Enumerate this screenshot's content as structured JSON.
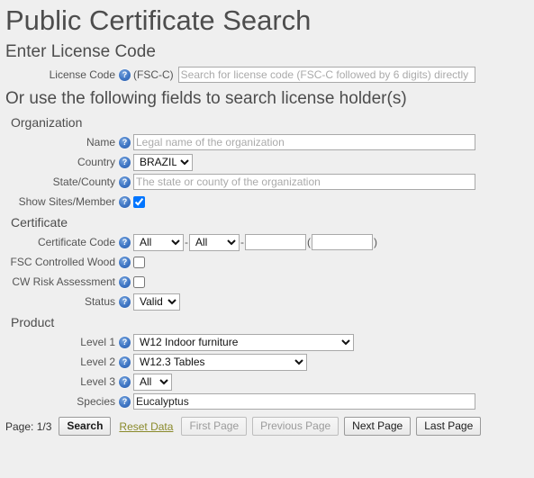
{
  "page": {
    "title": "Public Certificate Search"
  },
  "license_section": {
    "heading": "Enter License Code",
    "license_code": {
      "label": "License Code",
      "help_icon": "help-question-icon",
      "suffix": "(FSC-C)",
      "value": "",
      "placeholder": "Search for license code (FSC-C followed by 6 digits) directly"
    }
  },
  "holder_section": {
    "heading": "Or use the following fields to search license holder(s)",
    "organization": {
      "group_label": "Organization",
      "name": {
        "label": "Name",
        "help_icon": "help-question-icon",
        "value": "",
        "placeholder": "Legal name of the organization"
      },
      "country": {
        "label": "Country",
        "help_icon": "help-question-icon",
        "selected": "BRAZIL",
        "options": [
          "BRAZIL"
        ]
      },
      "state_county": {
        "label": "State/County",
        "help_icon": "help-question-icon",
        "value": "",
        "placeholder": "The state or county of the organization"
      },
      "show_sites_member": {
        "label": "Show Sites/Member",
        "help_icon": "help-question-icon",
        "checked": true
      }
    },
    "certificate": {
      "group_label": "Certificate",
      "certificate_code": {
        "label": "Certificate Code",
        "help_icon": "help-question-icon",
        "part1_selected": "All",
        "part1_options": [
          "All"
        ],
        "separator1": "-",
        "part2_selected": "All",
        "part2_options": [
          "All"
        ],
        "separator2": "-",
        "part3_value": "",
        "paren_open": "(",
        "part4_value": "",
        "paren_close": ")"
      },
      "fsc_controlled_wood": {
        "label": "FSC Controlled Wood",
        "help_icon": "help-question-icon",
        "checked": false
      },
      "cw_risk_assessment": {
        "label": "CW Risk Assessment",
        "help_icon": "help-question-icon",
        "checked": false
      },
      "status": {
        "label": "Status",
        "help_icon": "help-question-icon",
        "selected": "Valid",
        "options": [
          "Valid"
        ]
      }
    },
    "product": {
      "group_label": "Product",
      "level1": {
        "label": "Level 1",
        "help_icon": "help-question-icon",
        "selected": "W12 Indoor furniture",
        "options": [
          "W12 Indoor furniture"
        ]
      },
      "level2": {
        "label": "Level 2",
        "help_icon": "help-question-icon",
        "selected": "W12.3 Tables",
        "options": [
          "W12.3 Tables"
        ]
      },
      "level3": {
        "label": "Level 3",
        "help_icon": "help-question-icon",
        "selected": "All",
        "options": [
          "All"
        ]
      },
      "species": {
        "label": "Species",
        "help_icon": "help-question-icon",
        "value": "Eucalyptus",
        "placeholder": ""
      }
    }
  },
  "toolbar": {
    "page_indicator": "Page: 1/3",
    "search_label": "Search",
    "reset_label": "Reset Data",
    "first_page_label": "First Page",
    "previous_page_label": "Previous Page",
    "next_page_label": "Next Page",
    "last_page_label": "Last Page",
    "first_page_enabled": false,
    "previous_page_enabled": false,
    "next_page_enabled": true,
    "last_page_enabled": true
  },
  "colors": {
    "background": "#efefef",
    "heading_text": "#4d4d4d",
    "label_text": "#555555",
    "help_icon_blue": "#3f76c4",
    "link_olive": "#8a8a2b",
    "input_border": "#a9a9a9",
    "placeholder_text": "#aaaaaa",
    "disabled_text": "#9b9b9b"
  }
}
